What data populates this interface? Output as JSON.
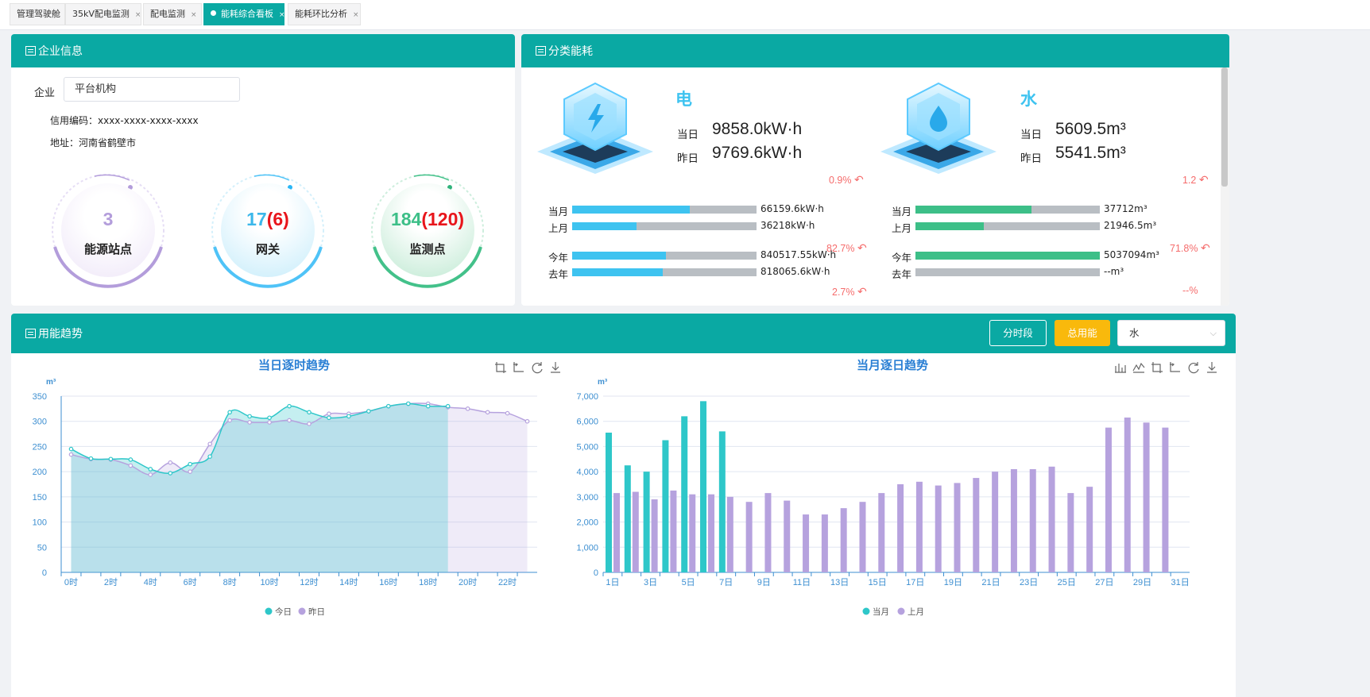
{
  "tabs": [
    {
      "label": "管理驾驶舱"
    },
    {
      "label": "35kV配电监测"
    },
    {
      "label": "配电监测"
    },
    {
      "label": "能耗综合看板",
      "active": true
    },
    {
      "label": "能耗环比分析"
    }
  ],
  "enterprise": {
    "title": "企业信息",
    "company_label": "企业",
    "company_value": "平台机构",
    "credit_code": "信用编码：xxxx-xxxx-xxxx-xxxx",
    "address": "地址：河南省鹤壁市",
    "stats": [
      {
        "value": "3",
        "extra": "",
        "label": "能源站点",
        "color": "#b39ddb"
      },
      {
        "value": "17",
        "extra": "(6)",
        "label": "网关",
        "color": "#4fc3f7"
      },
      {
        "value": "184",
        "extra": "(120)",
        "label": "监测点",
        "color": "#43c18a"
      }
    ]
  },
  "category": {
    "title": "分类能耗",
    "electric": {
      "name": "电",
      "today_label": "当日",
      "today": "9858.0kW·h",
      "yesterday_label": "昨日",
      "yesterday": "9769.6kW·h",
      "day_change": "0.9%",
      "rows": [
        {
          "label": "当月",
          "value": "66159.6kW·h",
          "fill": 0.64
        },
        {
          "label": "上月",
          "value": "36218kW·h",
          "fill": 0.35
        }
      ],
      "month_change": "82.7%",
      "rows2": [
        {
          "label": "今年",
          "value": "840517.55kW·h",
          "fill": 0.51
        },
        {
          "label": "去年",
          "value": "818065.6kW·h",
          "fill": 0.49
        }
      ],
      "year_change": "2.7%"
    },
    "water": {
      "name": "水",
      "today_label": "当日",
      "today": "5609.5m³",
      "yesterday_label": "昨日",
      "yesterday": "5541.5m³",
      "day_change": "1.2",
      "rows": [
        {
          "label": "当月",
          "value": "37712m³",
          "fill": 0.63
        },
        {
          "label": "上月",
          "value": "21946.5m³",
          "fill": 0.37
        }
      ],
      "month_change": "71.8%",
      "rows2": [
        {
          "label": "今年",
          "value": "5037094m³",
          "fill": 1.0
        },
        {
          "label": "去年",
          "value": "--m³",
          "fill": 0
        }
      ],
      "year_change": "--%"
    },
    "colors": {
      "electric": "#3ec3f0",
      "water": "#3dbf88"
    }
  },
  "trend": {
    "title": "用能趋势",
    "btn_period": "分时段",
    "btn_total": "总用能",
    "select_value": "水"
  },
  "chart_data": [
    {
      "type": "line",
      "title": "当日逐时趋势",
      "ylabel": "m³",
      "ylim": [
        0,
        350
      ],
      "yticks": [
        0,
        50,
        100,
        150,
        200,
        250,
        300,
        350
      ],
      "categories": [
        "0时",
        "1时",
        "2时",
        "3时",
        "4时",
        "5时",
        "6时",
        "7时",
        "8时",
        "9时",
        "10时",
        "11时",
        "12时",
        "13时",
        "14时",
        "15时",
        "16时",
        "17时",
        "18时",
        "19时",
        "20时",
        "21时",
        "22时",
        "23时"
      ],
      "xtick_labels": [
        "0时",
        "2时",
        "4时",
        "6时",
        "8时",
        "10时",
        "12时",
        "14时",
        "16时",
        "18时",
        "20时",
        "22时"
      ],
      "series": [
        {
          "name": "今日",
          "color": "#2ec7c9",
          "values": [
            245,
            226,
            225,
            224,
            205,
            197,
            215,
            230,
            318,
            310,
            307,
            330,
            318,
            307,
            310,
            320,
            330,
            335,
            330,
            330
          ]
        },
        {
          "name": "昨日",
          "color": "#b6a2de",
          "values": [
            234,
            225,
            224,
            212,
            194,
            218,
            200,
            255,
            302,
            298,
            298,
            302,
            295,
            315,
            315,
            320,
            330,
            335,
            335,
            328,
            325,
            318,
            316,
            300
          ]
        }
      ]
    },
    {
      "type": "bar",
      "title": "当月逐日趋势",
      "ylabel": "m³",
      "ylim": [
        0,
        7000
      ],
      "yticks": [
        "0",
        "1,000",
        "2,000",
        "3,000",
        "4,000",
        "5,000",
        "6,000",
        "7,000"
      ],
      "categories": [
        "1日",
        "2日",
        "3日",
        "4日",
        "5日",
        "6日",
        "7日",
        "8日",
        "9日",
        "10日",
        "11日",
        "12日",
        "13日",
        "14日",
        "15日",
        "16日",
        "17日",
        "18日",
        "19日",
        "20日",
        "21日",
        "22日",
        "23日",
        "24日",
        "25日",
        "26日",
        "27日",
        "28日",
        "29日",
        "30日",
        "31日"
      ],
      "xtick_labels": [
        "1日",
        "3日",
        "5日",
        "7日",
        "9日",
        "11日",
        "13日",
        "15日",
        "17日",
        "19日",
        "21日",
        "23日",
        "25日",
        "27日",
        "29日",
        "31日"
      ],
      "series": [
        {
          "name": "当月",
          "color": "#2ec7c9",
          "values": [
            5550,
            4250,
            4000,
            5250,
            6200,
            6800,
            5600
          ]
        },
        {
          "name": "上月",
          "color": "#b6a2de",
          "values": [
            3150,
            3200,
            2900,
            3250,
            3100,
            3100,
            3000,
            2800,
            3150,
            2850,
            2300,
            2300,
            2550,
            2800,
            3150,
            3500,
            3600,
            3450,
            3550,
            3750,
            4000,
            4100,
            4100,
            4200,
            3150,
            3400,
            5750,
            6150,
            5950,
            5750
          ]
        }
      ]
    }
  ]
}
